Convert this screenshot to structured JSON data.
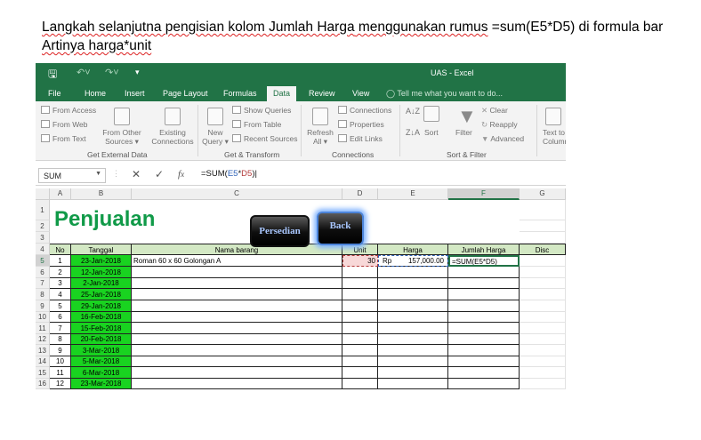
{
  "caption": {
    "line1_a": "Langkah selanjutna pengisian kolom Jumlah Harga",
    "line1_b": " menggunakan rumus",
    "line1_c": " =sum(E5*D5) di formula bar",
    "line2": "Artinya harga*unit"
  },
  "window": {
    "title": "UAS - Excel"
  },
  "tabs": [
    {
      "label": "File"
    },
    {
      "label": "Home"
    },
    {
      "label": "Insert"
    },
    {
      "label": "Page Layout"
    },
    {
      "label": "Formulas"
    },
    {
      "label": "Data"
    },
    {
      "label": "Review"
    },
    {
      "label": "View"
    }
  ],
  "tell_me": "Tell me what you want to do...",
  "ribbon": {
    "from_access": "From Access",
    "from_web": "From Web",
    "from_text": "From Text",
    "from_other_sources": [
      "From Other",
      "Sources"
    ],
    "existing_connections": [
      "Existing",
      "Connections"
    ],
    "new_query": [
      "New",
      "Query"
    ],
    "show_queries": "Show Queries",
    "from_table": "From Table",
    "recent_sources": "Recent Sources",
    "refresh_all": [
      "Refresh",
      "All"
    ],
    "connections": "Connections",
    "properties": "Properties",
    "edit_links": "Edit Links",
    "sort": "Sort",
    "filter": "Filter",
    "clear": "Clear",
    "reapply": "Reapply",
    "advanced": "Advanced",
    "text_to_columns": [
      "Text to",
      "Column"
    ],
    "groups": {
      "get_external_data": "Get External Data",
      "get_transform": "Get & Transform",
      "connections": "Connections",
      "sort_filter": "Sort & Filter"
    }
  },
  "formula_bar": {
    "name_box": "SUM",
    "formula_prefix": "=SUM(",
    "ref1": "E5",
    "op": "*",
    "ref2": "D5",
    "formula_suffix": ")"
  },
  "columns": [
    "A",
    "B",
    "C",
    "D",
    "E",
    "F",
    "G"
  ],
  "sheet": {
    "title": "Penjualan",
    "button_persedian": "Persedian",
    "button_back": "Back",
    "headers": [
      "No",
      "Tanggal",
      "Nama barang",
      "Unit",
      "Harga",
      "Jumlah Harga",
      "Disc"
    ],
    "row5": {
      "nama": "Roman 60 x 60 Golongan A",
      "unit": "30",
      "currency": "Rp",
      "harga": "157,000.00",
      "jumlah": "=SUM(E5*D5)"
    },
    "rows": [
      {
        "no": "1",
        "tanggal": "23-Jan-2018"
      },
      {
        "no": "2",
        "tanggal": "12-Jan-2018"
      },
      {
        "no": "3",
        "tanggal": "2-Jan-2018"
      },
      {
        "no": "4",
        "tanggal": "25-Jan-2018"
      },
      {
        "no": "5",
        "tanggal": "29-Jan-2018"
      },
      {
        "no": "6",
        "tanggal": "16-Feb-2018"
      },
      {
        "no": "7",
        "tanggal": "15-Feb-2018"
      },
      {
        "no": "8",
        "tanggal": "20-Feb-2018"
      },
      {
        "no": "9",
        "tanggal": "3-Mar-2018"
      },
      {
        "no": "10",
        "tanggal": "5-Mar-2018"
      },
      {
        "no": "11",
        "tanggal": "6-Mar-2018"
      },
      {
        "no": "12",
        "tanggal": "23-Mar-2018"
      }
    ],
    "row_numbers": [
      "1",
      "2",
      "3",
      "4",
      "5",
      "6",
      "7",
      "8",
      "9",
      "10",
      "11",
      "12",
      "13",
      "14",
      "15",
      "16"
    ]
  },
  "colors": {
    "excel_green": "#217346",
    "date_fill": "#19d320",
    "header_fill": "#d3e8c4",
    "title_green": "#109a48"
  }
}
